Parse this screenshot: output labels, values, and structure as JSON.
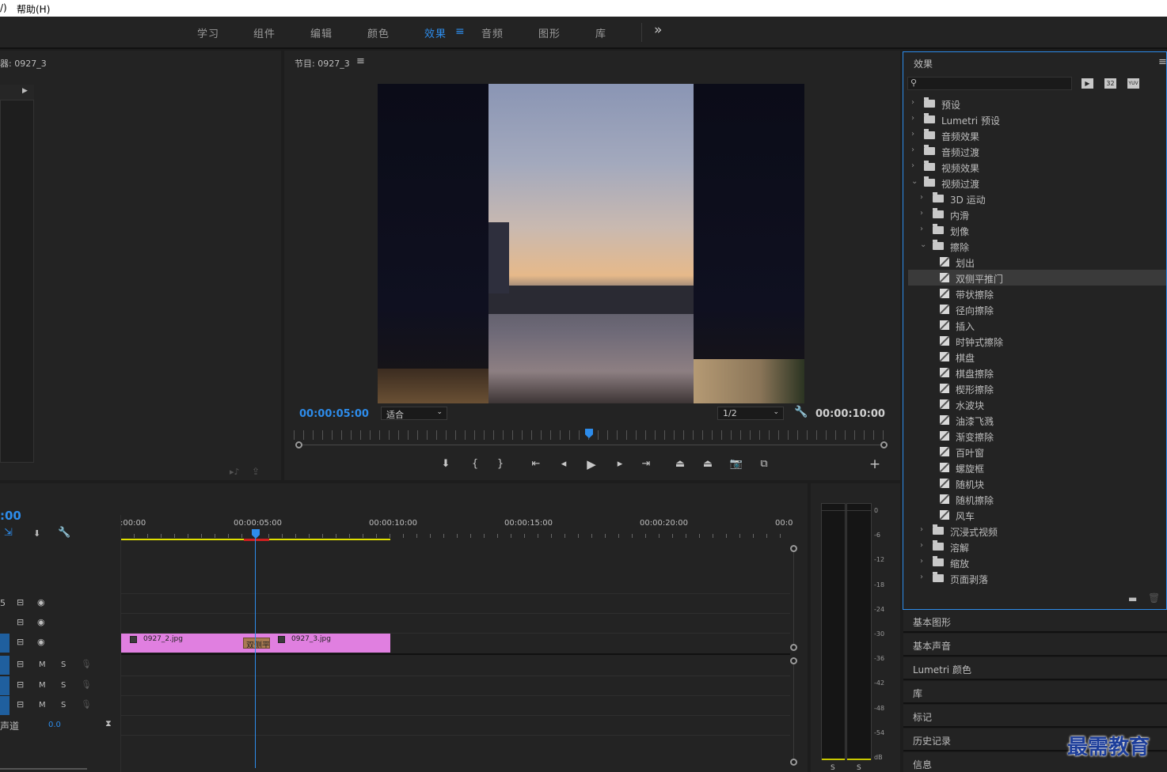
{
  "menubar": {
    "item_0": "/)",
    "item_1": "帮助(H)"
  },
  "workspace": {
    "tabs": [
      "学习",
      "组件",
      "编辑",
      "颜色",
      "效果",
      "音频",
      "图形",
      "库"
    ],
    "active_tab": "效果",
    "more_label": "»"
  },
  "source_panel": {
    "title": "器: 0927_3"
  },
  "program": {
    "title": "节目: 0927_3",
    "current_tc": "00:00:05:00",
    "duration_tc": "00:00:10:00",
    "zoom": "适合",
    "resolution": "1/2",
    "playhead_fraction": 0.5
  },
  "effects": {
    "title": "效果",
    "search_placeholder": "",
    "icons": [
      "accelerated-effects-icon",
      "32bit-icon",
      "yuv-icon"
    ],
    "badge_32": "32",
    "badge_yuv": "YUV",
    "items": [
      {
        "label": "预设",
        "level": 0,
        "open": false,
        "kind": "folder"
      },
      {
        "label": "Lumetri 预设",
        "level": 0,
        "open": false,
        "kind": "folder"
      },
      {
        "label": "音频效果",
        "level": 0,
        "open": false,
        "kind": "folder"
      },
      {
        "label": "音频过渡",
        "level": 0,
        "open": false,
        "kind": "folder"
      },
      {
        "label": "视频效果",
        "level": 0,
        "open": false,
        "kind": "folder"
      },
      {
        "label": "视频过渡",
        "level": 0,
        "open": true,
        "kind": "folder"
      },
      {
        "label": "3D 运动",
        "level": 1,
        "open": false,
        "kind": "folder"
      },
      {
        "label": "内滑",
        "level": 1,
        "open": false,
        "kind": "folder"
      },
      {
        "label": "划像",
        "level": 1,
        "open": false,
        "kind": "folder"
      },
      {
        "label": "擦除",
        "level": 1,
        "open": true,
        "kind": "folder"
      },
      {
        "label": "划出",
        "level": 2,
        "kind": "effect"
      },
      {
        "label": "双侧平推门",
        "level": 2,
        "kind": "effect",
        "selected": true
      },
      {
        "label": "带状擦除",
        "level": 2,
        "kind": "effect"
      },
      {
        "label": "径向擦除",
        "level": 2,
        "kind": "effect"
      },
      {
        "label": "插入",
        "level": 2,
        "kind": "effect"
      },
      {
        "label": "时钟式擦除",
        "level": 2,
        "kind": "effect"
      },
      {
        "label": "棋盘",
        "level": 2,
        "kind": "effect"
      },
      {
        "label": "棋盘擦除",
        "level": 2,
        "kind": "effect"
      },
      {
        "label": "楔形擦除",
        "level": 2,
        "kind": "effect"
      },
      {
        "label": "水波块",
        "level": 2,
        "kind": "effect"
      },
      {
        "label": "油漆飞溅",
        "level": 2,
        "kind": "effect"
      },
      {
        "label": "渐变擦除",
        "level": 2,
        "kind": "effect"
      },
      {
        "label": "百叶窗",
        "level": 2,
        "kind": "effect"
      },
      {
        "label": "螺旋框",
        "level": 2,
        "kind": "effect"
      },
      {
        "label": "随机块",
        "level": 2,
        "kind": "effect"
      },
      {
        "label": "随机擦除",
        "level": 2,
        "kind": "effect"
      },
      {
        "label": "风车",
        "level": 2,
        "kind": "effect"
      },
      {
        "label": "沉浸式视频",
        "level": 1,
        "open": false,
        "kind": "folder"
      },
      {
        "label": "溶解",
        "level": 1,
        "open": false,
        "kind": "folder"
      },
      {
        "label": "缩放",
        "level": 1,
        "open": false,
        "kind": "folder"
      },
      {
        "label": "页面剥落",
        "level": 1,
        "open": false,
        "kind": "folder"
      }
    ]
  },
  "side_panels": [
    "基本图形",
    "基本声音",
    "Lumetri 颜色",
    "库",
    "标记",
    "历史记录",
    "信息"
  ],
  "timeline": {
    "timecode": ":00",
    "ruler_labels": [
      ":00:00",
      "00:00:05:00",
      "00:00:10:00",
      "00:00:15:00",
      "00:00:20:00",
      "00:0"
    ],
    "clips": [
      {
        "name": "0927_2.jpg",
        "track": "V1"
      },
      {
        "name": "0927_3.jpg",
        "track": "V1"
      }
    ],
    "transition_label": "双侧平",
    "audio_m": "M",
    "audio_s": "S",
    "master_label": "声道",
    "master_value": "0.0"
  },
  "meter": {
    "scale": [
      "0",
      "-6",
      "-12",
      "-18",
      "-24",
      "-30",
      "-36",
      "-42",
      "-48",
      "-54",
      "dB"
    ],
    "solo_l": "S",
    "solo_r": "S"
  },
  "watermark": "最需教育",
  "colors": {
    "accent": "#2d8ceb",
    "clip": "#e07fe0",
    "work_area": "#e0e000",
    "playhead": "#2d8ceb"
  }
}
